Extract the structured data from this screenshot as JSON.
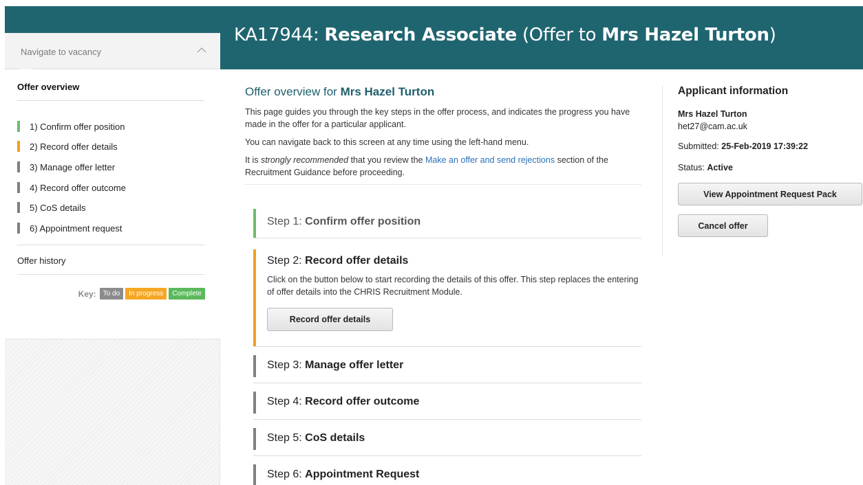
{
  "header": {
    "ref": "KA17944:",
    "job_title": "Research Associate",
    "offer_prefix": "(Offer to",
    "applicant": "Mrs Hazel Turton",
    "offer_suffix": ")"
  },
  "sidebar": {
    "navigate_label": "Navigate to vacancy",
    "heading": "Offer overview",
    "items": [
      {
        "label": "1) Confirm offer position",
        "color": "#6cbd6c"
      },
      {
        "label": "2) Record offer details",
        "color": "#f0a020"
      },
      {
        "label": "3) Manage offer letter",
        "color": "#808080"
      },
      {
        "label": "4) Record offer outcome",
        "color": "#808080"
      },
      {
        "label": "5) CoS details",
        "color": "#808080"
      },
      {
        "label": "6) Appointment request",
        "color": "#808080"
      }
    ],
    "history_label": "Offer history",
    "key": {
      "label": "Key:",
      "todo": "To do",
      "in_progress": "In progress",
      "complete": "Complete",
      "colors": {
        "todo": "#8c8c8c",
        "in_progress": "#f5a623",
        "complete": "#5cb85c"
      }
    }
  },
  "main": {
    "title_prefix": "Offer overview for",
    "title_name": "Mrs Hazel Turton",
    "para1": "This page guides you through the key steps in the offer process, and indicates the progress you have made in the offer for a particular applicant.",
    "para2": "You can navigate back to this screen at any time using the left-hand menu.",
    "para3_pre": "It is",
    "para3_em": "strongly recommended",
    "para3_mid": "that you review the",
    "para3_link": "Make an offer and send rejections",
    "para3_post": "section of the Recruitment Guidance before proceeding.",
    "steps": [
      {
        "prefix": "Step 1:",
        "name": "Confirm offer position",
        "color": "#6cbd6c"
      },
      {
        "prefix": "Step 2:",
        "name": "Record offer details",
        "color": "#f0a020",
        "body": "Click on the button below to start recording the details of this offer. This step replaces the entering of offer details into the CHRIS Recruitment Module.",
        "button": "Record offer details"
      },
      {
        "prefix": "Step 3:",
        "name": "Manage offer letter",
        "color": "#808080"
      },
      {
        "prefix": "Step 4:",
        "name": "Record offer outcome",
        "color": "#808080"
      },
      {
        "prefix": "Step 5:",
        "name": "CoS details",
        "color": "#808080"
      },
      {
        "prefix": "Step 6:",
        "name": "Appointment Request",
        "color": "#808080"
      }
    ]
  },
  "info": {
    "title": "Applicant information",
    "name": "Mrs Hazel Turton",
    "email": "het27@cam.ac.uk",
    "submitted_label": "Submitted:",
    "submitted_value": "25-Feb-2019 17:39:22",
    "status_label": "Status:",
    "status_value": "Active",
    "view_pack_button": "View Appointment Request Pack",
    "cancel_button": "Cancel offer"
  }
}
